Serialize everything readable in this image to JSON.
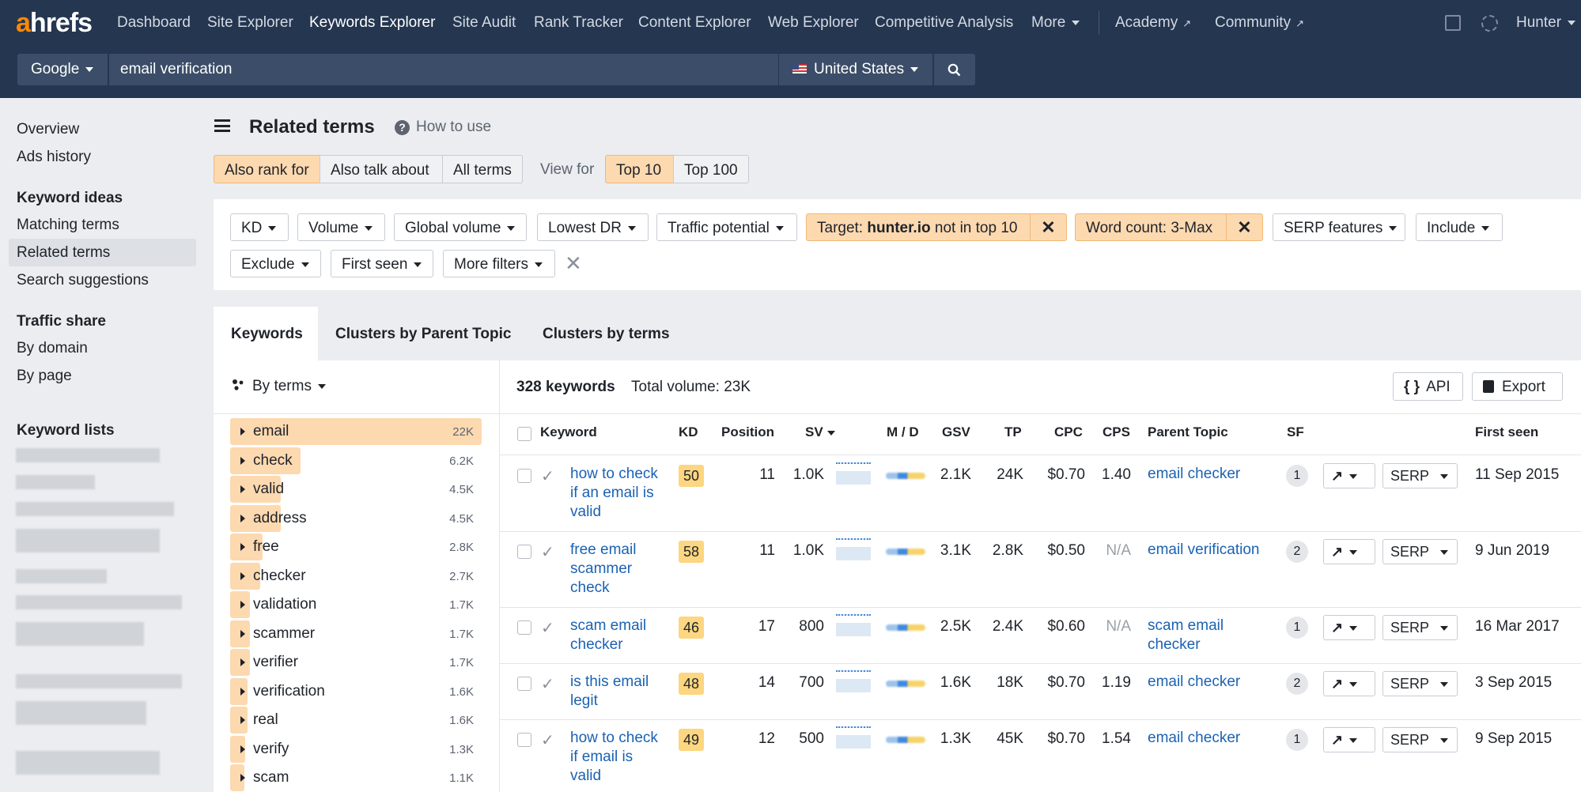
{
  "nav": {
    "logo": "ahrefs",
    "items": [
      "Dashboard",
      "Site Explorer",
      "Keywords Explorer",
      "Site Audit",
      "Rank Tracker",
      "Content Explorer",
      "Web Explorer",
      "Competitive Analysis",
      "More"
    ],
    "academy": "Academy",
    "community": "Community",
    "user": "Hunter"
  },
  "search": {
    "engine": "Google",
    "query": "email verification",
    "country": "United States"
  },
  "sidebar": {
    "overview": "Overview",
    "ads_history": "Ads history",
    "keyword_ideas_head": "Keyword ideas",
    "matching_terms": "Matching terms",
    "related_terms": "Related terms",
    "search_suggestions": "Search suggestions",
    "traffic_share_head": "Traffic share",
    "by_domain": "By domain",
    "by_page": "By page",
    "keyword_lists_head": "Keyword lists"
  },
  "header": {
    "title": "Related terms",
    "how_to_use": "How to use",
    "modes": [
      "Also rank for",
      "Also talk about",
      "All terms"
    ],
    "view_for_label": "View for",
    "view_options": [
      "Top 10",
      "Top 100"
    ]
  },
  "filters": {
    "kd": "KD",
    "volume": "Volume",
    "global_volume": "Global volume",
    "lowest_dr": "Lowest DR",
    "traffic_potential": "Traffic potential",
    "target_prefix": "Target:",
    "target_domain": "hunter.io",
    "target_suffix": "not in top 10",
    "word_count": "Word count: 3-Max",
    "serp_features": "SERP features",
    "include": "Include",
    "exclude": "Exclude",
    "first_seen": "First seen",
    "more_filters": "More filters"
  },
  "tabs": [
    "Keywords",
    "Clusters by Parent Topic",
    "Clusters by terms"
  ],
  "clusters": {
    "by_terms_label": "By terms",
    "terms": [
      {
        "term": "email",
        "count": "22K",
        "share": 1.0
      },
      {
        "term": "check",
        "count": "6.2K",
        "share": 0.28
      },
      {
        "term": "valid",
        "count": "4.5K",
        "share": 0.2
      },
      {
        "term": "address",
        "count": "4.5K",
        "share": 0.2
      },
      {
        "term": "free",
        "count": "2.8K",
        "share": 0.13
      },
      {
        "term": "checker",
        "count": "2.7K",
        "share": 0.12
      },
      {
        "term": "validation",
        "count": "1.7K",
        "share": 0.08
      },
      {
        "term": "scammer",
        "count": "1.7K",
        "share": 0.08
      },
      {
        "term": "verifier",
        "count": "1.7K",
        "share": 0.08
      },
      {
        "term": "verification",
        "count": "1.6K",
        "share": 0.07
      },
      {
        "term": "real",
        "count": "1.6K",
        "share": 0.07
      },
      {
        "term": "verify",
        "count": "1.3K",
        "share": 0.06
      },
      {
        "term": "scam",
        "count": "1.1K",
        "share": 0.05
      }
    ]
  },
  "results": {
    "keyword_count": "328 keywords",
    "total_volume": "Total volume: 23K",
    "api_label": "API",
    "export_label": "Export",
    "columns": [
      "Keyword",
      "KD",
      "Position",
      "SV",
      "M / D",
      "GSV",
      "TP",
      "CPC",
      "CPS",
      "Parent Topic",
      "SF",
      "First seen"
    ],
    "rows": [
      {
        "keyword": [
          "how to check",
          "if an email is",
          "valid"
        ],
        "kd": "50",
        "position": "11",
        "sv": "1.0K",
        "gsv": "2.1K",
        "tp": "24K",
        "cpc": "$0.70",
        "cps": "1.40",
        "parent": [
          "email checker"
        ],
        "sf": "1",
        "serp": "SERP",
        "first_seen": "11 Sep 2015"
      },
      {
        "keyword": [
          "free email",
          "scammer",
          "check"
        ],
        "kd": "58",
        "position": "11",
        "sv": "1.0K",
        "gsv": "3.1K",
        "tp": "2.8K",
        "cpc": "$0.50",
        "cps": "N/A",
        "parent": [
          "email verification"
        ],
        "sf": "2",
        "serp": "SERP",
        "first_seen": "9 Jun 2019"
      },
      {
        "keyword": [
          "scam email",
          "checker"
        ],
        "kd": "46",
        "position": "17",
        "sv": "800",
        "gsv": "2.5K",
        "tp": "2.4K",
        "cpc": "$0.60",
        "cps": "N/A",
        "parent": [
          "scam email",
          "checker"
        ],
        "sf": "1",
        "serp": "SERP",
        "first_seen": "16 Mar 2017"
      },
      {
        "keyword": [
          "is this email",
          "legit"
        ],
        "kd": "48",
        "position": "14",
        "sv": "700",
        "gsv": "1.6K",
        "tp": "18K",
        "cpc": "$0.70",
        "cps": "1.19",
        "parent": [
          "email checker"
        ],
        "sf": "2",
        "serp": "SERP",
        "first_seen": "3 Sep 2015"
      },
      {
        "keyword": [
          "how to check",
          "if email is",
          "valid"
        ],
        "kd": "49",
        "position": "12",
        "sv": "500",
        "gsv": "1.3K",
        "tp": "45K",
        "cpc": "$0.70",
        "cps": "1.54",
        "parent": [
          "email checker"
        ],
        "sf": "1",
        "serp": "SERP",
        "first_seen": "9 Sep 2015"
      }
    ]
  },
  "colors": {
    "nav_bg": "#243650",
    "accent_orange": "#ff8800",
    "highlight": "#fdd9b0",
    "link": "#1a62b3",
    "kd_badge": "#fcd680"
  }
}
